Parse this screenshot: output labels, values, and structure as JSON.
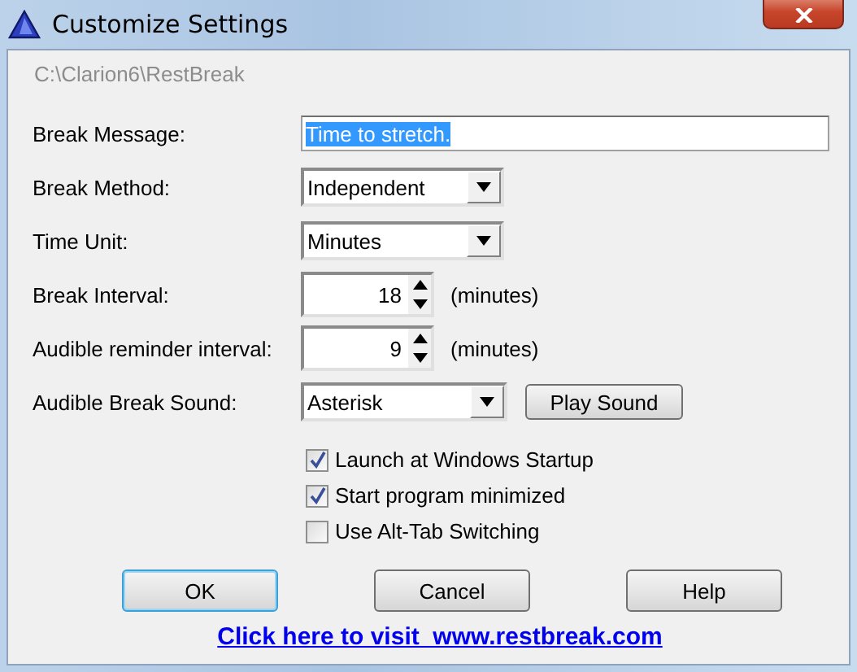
{
  "window": {
    "title": "Customize Settings"
  },
  "path": "C:\\Clarion6\\RestBreak",
  "fields": [
    {
      "kind": "text",
      "label": "Break Message:",
      "value": "Time to stretch.",
      "text_selected": true
    },
    {
      "kind": "combo",
      "label": "Break Method:",
      "value": "Independent"
    },
    {
      "kind": "combo",
      "label": "Time Unit:",
      "value": "Minutes"
    },
    {
      "kind": "spin",
      "label": "Break Interval:",
      "value": "18",
      "unit": "(minutes)"
    },
    {
      "kind": "spin",
      "label": "Audible reminder interval:",
      "value": "9",
      "unit": "(minutes)"
    },
    {
      "kind": "combo",
      "label": "Audible Break Sound:",
      "value": "Asterisk",
      "button": "Play Sound"
    }
  ],
  "checkboxes": [
    {
      "label": "Launch at Windows Startup",
      "checked": true
    },
    {
      "label": "Start program minimized",
      "checked": true
    },
    {
      "label": "Use Alt-Tab Switching",
      "checked": false
    }
  ],
  "buttons": [
    {
      "label": "OK",
      "focused": true
    },
    {
      "label": "Cancel",
      "focused": false
    },
    {
      "label": "Help",
      "focused": false
    }
  ],
  "link": "Click here to visit  www.restbreak.com"
}
